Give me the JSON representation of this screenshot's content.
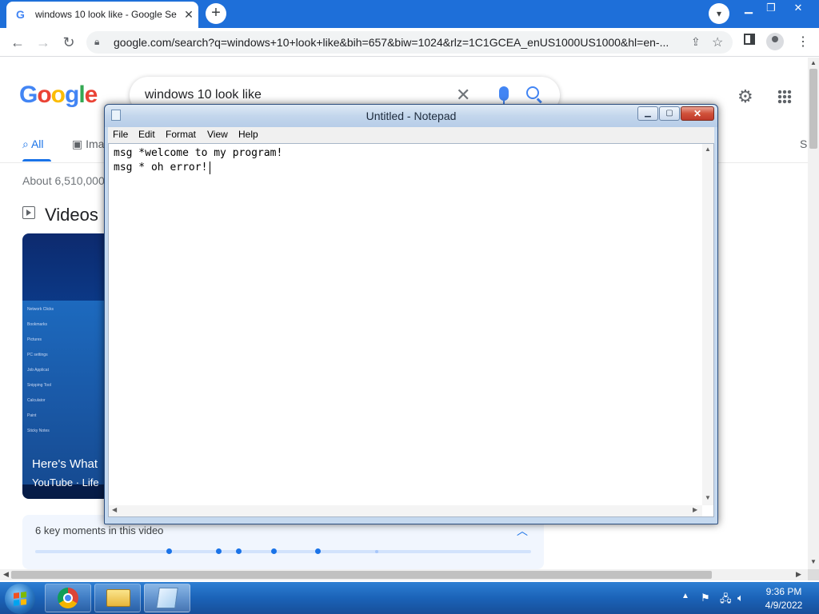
{
  "browser": {
    "tab": {
      "favicon": "google-g-icon",
      "title": "windows 10 look like - Google Se"
    },
    "url": "google.com/search?q=windows+10+look+like&bih=657&biw=1024&rlz=1C1GCEA_enUS1000US1000&hl=en-..."
  },
  "google": {
    "logo": [
      "G",
      "o",
      "o",
      "g",
      "l",
      "e"
    ],
    "logo_colors": [
      "#4285f4",
      "#ea4335",
      "#fbbc05",
      "#4285f4",
      "#34a853",
      "#ea4335"
    ],
    "query": "windows 10 look like",
    "tabs": {
      "all": "All",
      "images": "Ima",
      "more": "S"
    },
    "result_stats": "About 6,510,000",
    "videos_heading": "Videos",
    "video": {
      "title": "Here's What",
      "source": "YouTube · Life",
      "menu_items": [
        "Network Clicks",
        "Bookmarks",
        "Pictures",
        "PC settings",
        "Job Applicat",
        "Snipping Tool",
        "Calculator",
        "Paint",
        "Sticky Notes"
      ]
    },
    "key_moments": {
      "label": "6 key moments in this video",
      "dots": [
        0.27,
        0.37,
        0.41,
        0.48,
        0.57,
        0.69
      ]
    }
  },
  "notepad": {
    "title": "Untitled - Notepad",
    "menu": [
      "File",
      "Edit",
      "Format",
      "View",
      "Help"
    ],
    "lines": [
      "msg *welcome to my program!",
      "msg * oh error!"
    ]
  },
  "taskbar": {
    "tasks": [
      "chrome-icon",
      "file-explorer-icon",
      "notepad-icon"
    ],
    "clock": {
      "time": "9:36 PM",
      "date": "4/9/2022"
    }
  }
}
